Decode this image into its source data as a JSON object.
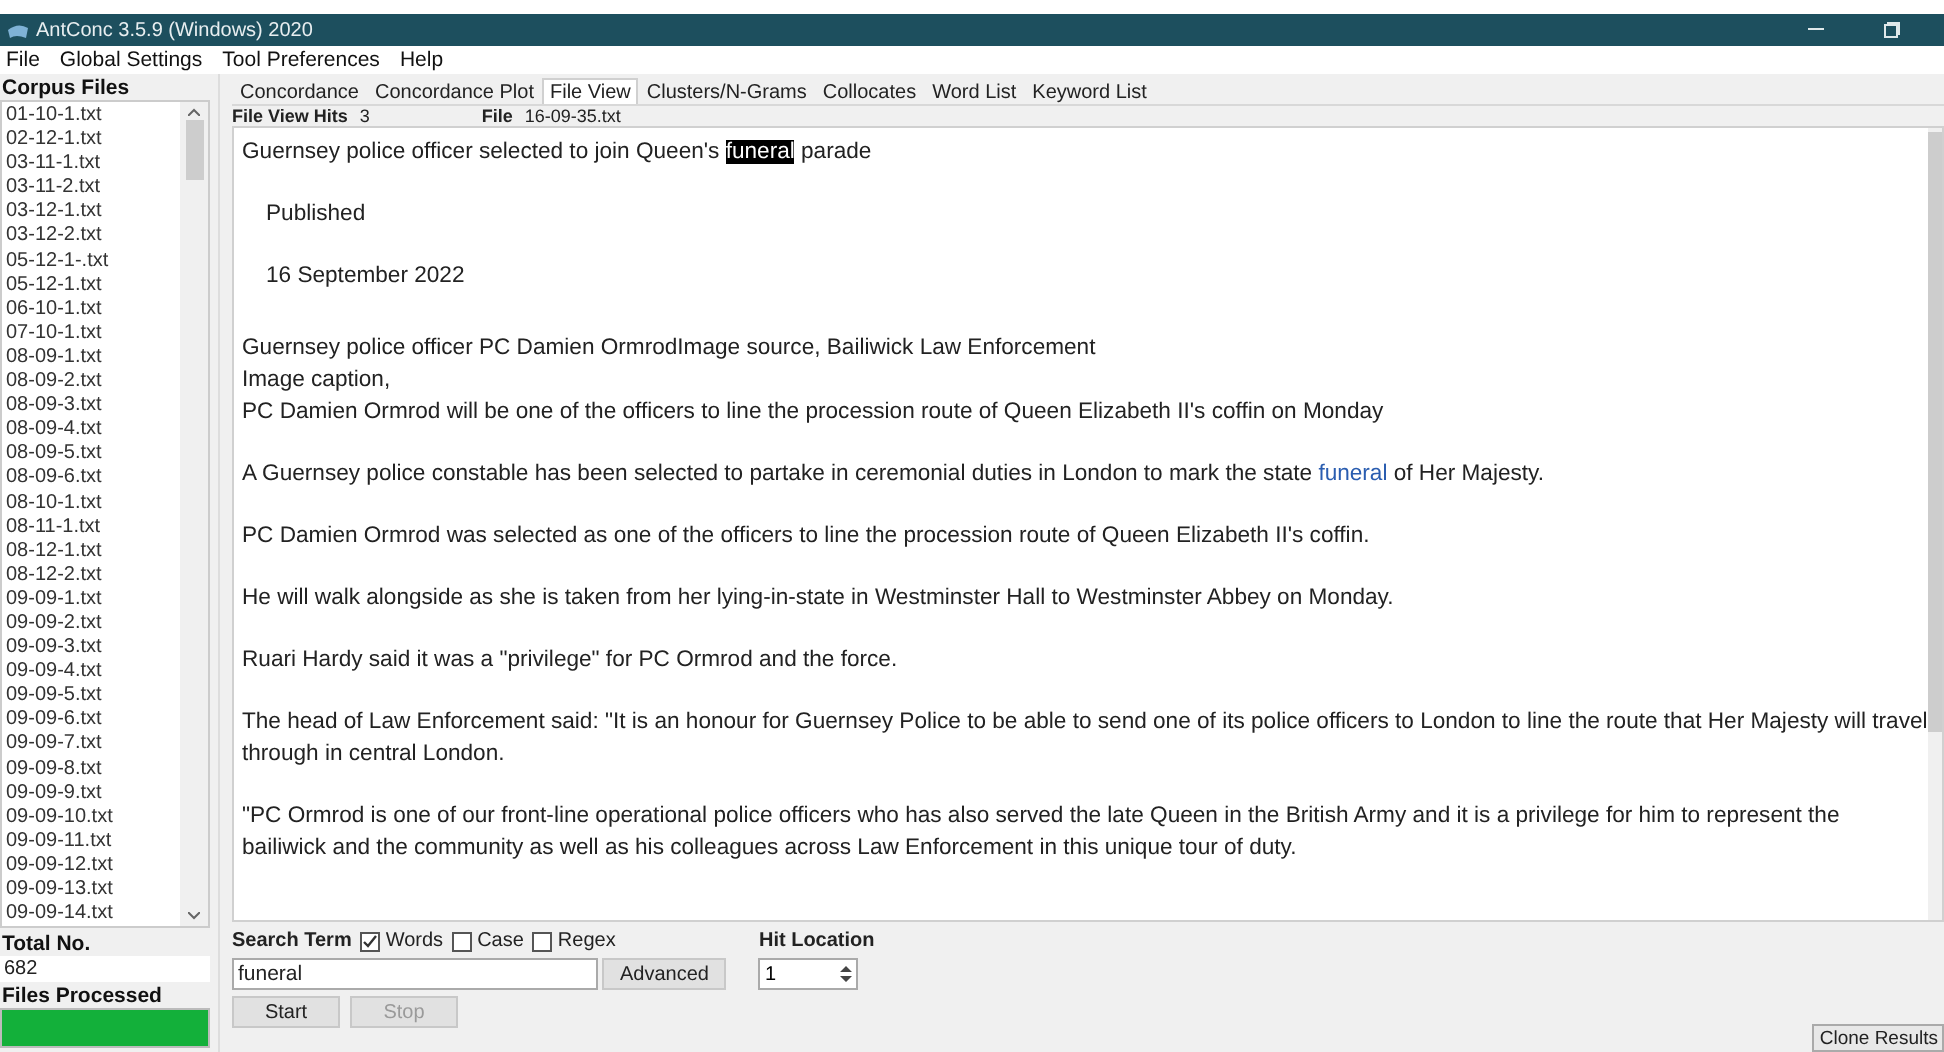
{
  "window": {
    "title": "AntConc 3.5.9 (Windows) 2020"
  },
  "menu": [
    "File",
    "Global Settings",
    "Tool Preferences",
    "Help"
  ],
  "corpus": {
    "label": "Corpus Files",
    "files": [
      {
        "name": "01-10-1.txt"
      },
      {
        "name": "02-12-1.txt"
      },
      {
        "name": "03-11-1.txt"
      },
      {
        "name": "03-11-2.txt"
      },
      {
        "name": "03-12-1.txt"
      },
      {
        "name": "03-12-2.txt"
      },
      {
        "name": "05-12-1-.txt"
      },
      {
        "name": "05-12-1.txt"
      },
      {
        "name": "06-10-1.txt"
      },
      {
        "name": "07-10-1.txt"
      },
      {
        "name": "08-09-1.txt"
      },
      {
        "name": "08-09-2.txt"
      },
      {
        "name": "08-09-3.txt"
      },
      {
        "name": "08-09-4.txt"
      },
      {
        "name": "08-09-5.txt"
      },
      {
        "name": "08-09-6.txt"
      },
      {
        "name": "08-10-1.txt"
      },
      {
        "name": "08-11-1.txt"
      },
      {
        "name": "08-12-1.txt"
      },
      {
        "name": "08-12-2.txt"
      },
      {
        "name": "09-09-1.txt"
      },
      {
        "name": "09-09-2.txt"
      },
      {
        "name": "09-09-3.txt"
      },
      {
        "name": "09-09-4.txt"
      },
      {
        "name": "09-09-5.txt"
      },
      {
        "name": "09-09-6.txt"
      },
      {
        "name": "09-09-7.txt"
      },
      {
        "name": "09-09-8.txt"
      },
      {
        "name": "09-09-9.txt"
      },
      {
        "name": "09-09-10.txt"
      },
      {
        "name": "09-09-11.txt"
      },
      {
        "name": "09-09-12.txt"
      },
      {
        "name": "09-09-13.txt"
      },
      {
        "name": "09-09-14.txt"
      }
    ],
    "total_label": "Total No.",
    "total": "682",
    "processed_label": "Files Processed",
    "progress": {
      "level": 1
    }
  },
  "tabs": [
    {
      "label": "Concordance",
      "selected": false
    },
    {
      "label": "Concordance Plot",
      "selected": false
    },
    {
      "label": "File View",
      "selected": true
    },
    {
      "label": "Clusters/N-Grams",
      "selected": false
    },
    {
      "label": "Collocates",
      "selected": false
    },
    {
      "label": "Word List",
      "selected": false
    },
    {
      "label": "Keyword List",
      "selected": false
    }
  ],
  "file_view": {
    "hits_label": "File View Hits",
    "hits": "3",
    "file_label": "File",
    "file": "16-09-35.txt",
    "paragraphs": [
      {
        "kind": "plain",
        "lines": [
          [
            {
              "kind": "plain",
              "text": "Guernsey police officer selected to join Queen's "
            },
            {
              "kind": "hit",
              "text": "funeral"
            },
            {
              "kind": "plain",
              "text": " parade"
            }
          ]
        ]
      },
      {
        "kind": "meta",
        "lines": [
          [
            {
              "kind": "plain",
              "text": "Published"
            }
          ]
        ]
      },
      {
        "kind": "meta",
        "lines": [
          [
            {
              "kind": "plain",
              "text": "16 September 2022"
            }
          ]
        ]
      },
      {
        "kind": "spaced",
        "lines": [
          [
            {
              "kind": "plain",
              "text": "Guernsey police officer PC Damien OrmrodImage source, Bailiwick Law Enforcement"
            }
          ],
          [
            {
              "kind": "plain",
              "text": "Image caption,"
            }
          ],
          [
            {
              "kind": "plain",
              "text": "PC Damien Ormrod will be one of the officers to line the procession route of Queen Elizabeth II's coffin on Monday"
            }
          ]
        ]
      },
      {
        "kind": "plain",
        "lines": [
          [
            {
              "kind": "plain",
              "text": "A Guernsey police constable has been selected to partake in ceremonial duties in London to mark the state "
            },
            {
              "kind": "match",
              "text": "funeral"
            },
            {
              "kind": "plain",
              "text": " of Her Majesty."
            }
          ]
        ]
      },
      {
        "kind": "plain",
        "lines": [
          [
            {
              "kind": "plain",
              "text": "PC Damien Ormrod was selected as one of the officers to line the procession route of Queen Elizabeth II's coffin."
            }
          ]
        ]
      },
      {
        "kind": "plain",
        "lines": [
          [
            {
              "kind": "plain",
              "text": "He will walk alongside as she is taken from her lying-in-state in Westminster Hall to Westminster Abbey on Monday."
            }
          ]
        ]
      },
      {
        "kind": "plain",
        "lines": [
          [
            {
              "kind": "plain",
              "text": "Ruari Hardy said it was a \"privilege\" for PC Ormrod and the force."
            }
          ]
        ]
      },
      {
        "kind": "plain",
        "lines": [
          [
            {
              "kind": "plain",
              "text": "The head of Law Enforcement said: \"It is an honour for Guernsey Police to be able to send one of its police officers to London to line the route that Her Majesty will travel"
            }
          ],
          [
            {
              "kind": "plain",
              "text": "through in central London."
            }
          ]
        ]
      },
      {
        "kind": "plain",
        "lines": [
          [
            {
              "kind": "plain",
              "text": "\"PC Ormrod is one of our front-line operational police officers who has also served the late Queen in the British Army and it is a privilege for him to represent the"
            }
          ],
          [
            {
              "kind": "plain",
              "text": "bailiwick and the community as well as his colleagues across Law Enforcement in this unique tour of duty."
            }
          ]
        ]
      }
    ]
  },
  "search": {
    "label": "Search Term",
    "options": [
      {
        "label": "Words",
        "checked": true
      },
      {
        "label": "Case",
        "checked": false
      },
      {
        "label": "Regex",
        "checked": false
      }
    ],
    "value": "funeral",
    "advanced": "Advanced",
    "start": {
      "label": "Start",
      "disabled": false
    },
    "stop": {
      "label": "Stop",
      "disabled": true
    }
  },
  "hit_location": {
    "label": "Hit Location",
    "value": "1"
  },
  "clone_button": "Clone Results"
}
